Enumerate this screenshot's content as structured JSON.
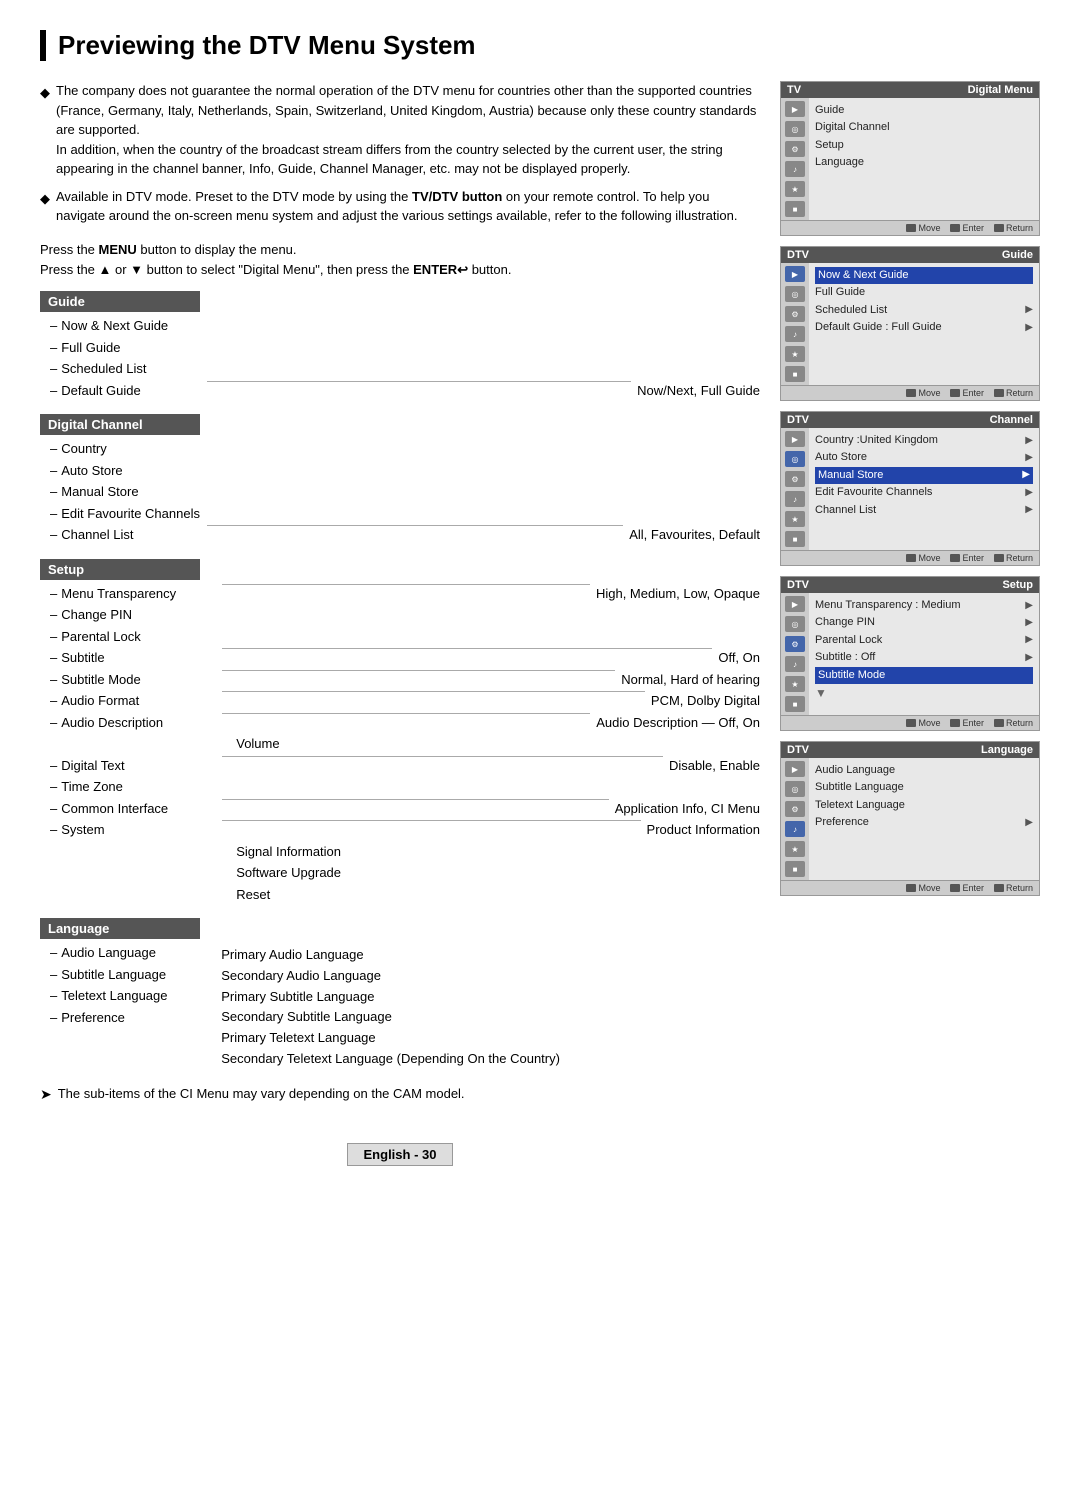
{
  "page": {
    "title": "Previewing the DTV Menu System"
  },
  "bullets": [
    {
      "text": "The company does not guarantee the normal operation of the DTV menu for countries other than the supported countries (France, Germany, Italy, Netherlands, Spain, Switzerland, United Kingdom, Austria) because only these country standards are supported. In addition, when the country of the broadcast stream differs from the country selected by the current user, the string appearing in the channel banner, Info, Guide, Channel Manager, etc. may not be displayed properly."
    },
    {
      "text": "Available in DTV mode. Preset to the DTV mode by using the TV/DTV button on your remote control. To help you navigate around the on-screen menu system and adjust the various settings available, refer to the following illustration."
    }
  ],
  "press_instructions": [
    "Press the MENU button to display the menu.",
    "Press the ▲ or ▼ button to select \"Digital Menu\", then press the ENTER↩ button."
  ],
  "menu_sections": [
    {
      "header": "Guide",
      "items": [
        {
          "label": "Now & Next Guide",
          "value": ""
        },
        {
          "label": "Full Guide",
          "value": ""
        },
        {
          "label": "Scheduled List",
          "value": ""
        },
        {
          "label": "Default Guide",
          "value": "Now/Next, Full Guide"
        }
      ]
    },
    {
      "header": "Digital Channel",
      "items": [
        {
          "label": "Country",
          "value": ""
        },
        {
          "label": "Auto Store",
          "value": ""
        },
        {
          "label": "Manual Store",
          "value": ""
        },
        {
          "label": "Edit Favourite Channels",
          "value": ""
        },
        {
          "label": "Channel List",
          "value": "All, Favourites, Default"
        }
      ]
    },
    {
      "header": "Setup",
      "items": [
        {
          "label": "Menu Transparency",
          "value": "High, Medium, Low, Opaque"
        },
        {
          "label": "Change PIN",
          "value": ""
        },
        {
          "label": "Parental Lock",
          "value": ""
        },
        {
          "label": "Subtitle",
          "value": "Off, On"
        },
        {
          "label": "Subtitle Mode",
          "value": "Normal, Hard of hearing"
        },
        {
          "label": "Audio Format",
          "value": "PCM, Dolby Digital"
        },
        {
          "label": "Audio Description",
          "value": "Audio Description — Off, On"
        },
        {
          "label": "",
          "value": "Volume"
        },
        {
          "label": "Digital Text",
          "value": "Disable, Enable"
        },
        {
          "label": "Time Zone",
          "value": ""
        },
        {
          "label": "Common Interface",
          "value": "Application Info, CI Menu"
        },
        {
          "label": "System",
          "value": "Product Information"
        },
        {
          "label": "",
          "value": "Signal Information"
        },
        {
          "label": "",
          "value": "Software Upgrade"
        },
        {
          "label": "",
          "value": "Reset"
        }
      ]
    },
    {
      "header": "Language",
      "items": [
        {
          "label": "Audio Language",
          "value": "Primary Audio Language"
        },
        {
          "label": "Subtitle Language",
          "value": "Secondary Audio Language"
        },
        {
          "label": "Teletext Language",
          "value": "Primary Subtitle Language"
        },
        {
          "label": "Preference",
          "value": "Secondary Subtitle Language"
        },
        {
          "label": "",
          "value": "Primary Teletext Language"
        },
        {
          "label": "",
          "value": "Secondary Teletext Language (Depending On the Country)"
        }
      ]
    }
  ],
  "note": "The sub-items of the CI Menu may vary depending on the CAM model.",
  "footer": "English - 30",
  "dtv_panels": [
    {
      "header_left": "TV",
      "header_right": "Digital Menu",
      "items": [
        {
          "label": "Guide",
          "selected": false
        },
        {
          "label": "Digital Channel",
          "selected": false
        },
        {
          "label": "Setup",
          "selected": false
        },
        {
          "label": "Language",
          "selected": false
        }
      ]
    },
    {
      "header_left": "DTV",
      "header_right": "Guide",
      "items": [
        {
          "label": "Now & Next Guide",
          "selected": true,
          "highlighted": true
        },
        {
          "label": "Full Guide",
          "selected": false
        },
        {
          "label": "Scheduled List",
          "selected": false,
          "arrow": true
        },
        {
          "label": "Default Guide  : Full Guide",
          "selected": false,
          "arrow": true
        }
      ]
    },
    {
      "header_left": "DTV",
      "header_right": "Channel",
      "items": [
        {
          "label": "Country       :United Kingdom",
          "selected": false,
          "arrow": true
        },
        {
          "label": "Auto Store",
          "selected": false,
          "arrow": true
        },
        {
          "label": "Manual Store",
          "selected": false,
          "arrow": true,
          "highlighted": true
        },
        {
          "label": "Edit Favourite Channels",
          "selected": false,
          "arrow": true
        },
        {
          "label": "Channel List",
          "selected": false,
          "arrow": true
        }
      ]
    },
    {
      "header_left": "DTV",
      "header_right": "Setup",
      "items": [
        {
          "label": "Menu Transparency : Medium",
          "selected": false,
          "arrow": true
        },
        {
          "label": "Change PIN",
          "selected": false,
          "arrow": true
        },
        {
          "label": "Parental Lock",
          "selected": false,
          "arrow": true
        },
        {
          "label": "Subtitle       : Off",
          "selected": false,
          "arrow": true
        },
        {
          "label": "Subtitle Mode",
          "selected": false,
          "highlighted": true
        }
      ]
    },
    {
      "header_left": "DTV",
      "header_right": "Language",
      "items": [
        {
          "label": "Audio Language",
          "selected": false
        },
        {
          "label": "Subtitle Language",
          "selected": false
        },
        {
          "label": "Teletext Language",
          "selected": false
        },
        {
          "label": "Preference",
          "selected": false,
          "arrow": true
        }
      ]
    }
  ]
}
